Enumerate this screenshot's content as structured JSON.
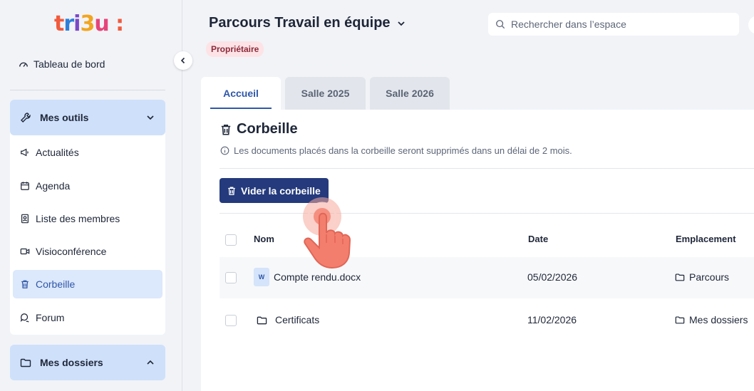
{
  "logo": {
    "text": "tri3u",
    "suffix": ":",
    "colors": [
      "#f15a3c",
      "#2f7fd8",
      "#7b47c7",
      "#f2a51f",
      "#e6447a"
    ]
  },
  "sidebar": {
    "dashboard_label": "Tableau de bord",
    "tools_group": {
      "label": "Mes outils",
      "expanded": true
    },
    "items": [
      {
        "label": "Actualités",
        "icon": "megaphone-icon"
      },
      {
        "label": "Agenda",
        "icon": "calendar-icon"
      },
      {
        "label": "Liste des membres",
        "icon": "contacts-icon"
      },
      {
        "label": "Visioconférence",
        "icon": "video-icon"
      },
      {
        "label": "Corbeille",
        "icon": "trash-icon",
        "active": true
      },
      {
        "label": "Forum",
        "icon": "chat-icon"
      }
    ],
    "folders_group": {
      "label": "Mes dossiers",
      "expanded": false
    }
  },
  "header": {
    "space_title": "Parcours Travail en équipe",
    "role_badge": "Propriétaire",
    "search_placeholder": "Rechercher dans l’espace"
  },
  "tabs": [
    {
      "label": "Accueil",
      "active": true
    },
    {
      "label": "Salle 2025",
      "active": false
    },
    {
      "label": "Salle 2026",
      "active": false
    }
  ],
  "trash": {
    "title": "Corbeille",
    "info": "Les documents placés dans la corbeille seront supprimés dans un délai de 2 mois.",
    "empty_button": "Vider la corbeille",
    "columns": {
      "name": "Nom",
      "date": "Date",
      "location": "Emplacement"
    },
    "rows": [
      {
        "type": "word-doc",
        "type_badge": "W",
        "name": "Compte rendu.docx",
        "date": "05/02/2026",
        "location": "Parcours"
      },
      {
        "type": "folder",
        "name": "Certificats",
        "date": "11/02/2026",
        "location": "Mes dossiers"
      }
    ]
  },
  "colors": {
    "accent": "#2f57a8",
    "primary_button": "#243a7c",
    "active_bg": "#dce8fb",
    "group_bg": "#cfe0fa",
    "badge_bg": "#fde3e6",
    "pointer": "#f47e6e"
  }
}
